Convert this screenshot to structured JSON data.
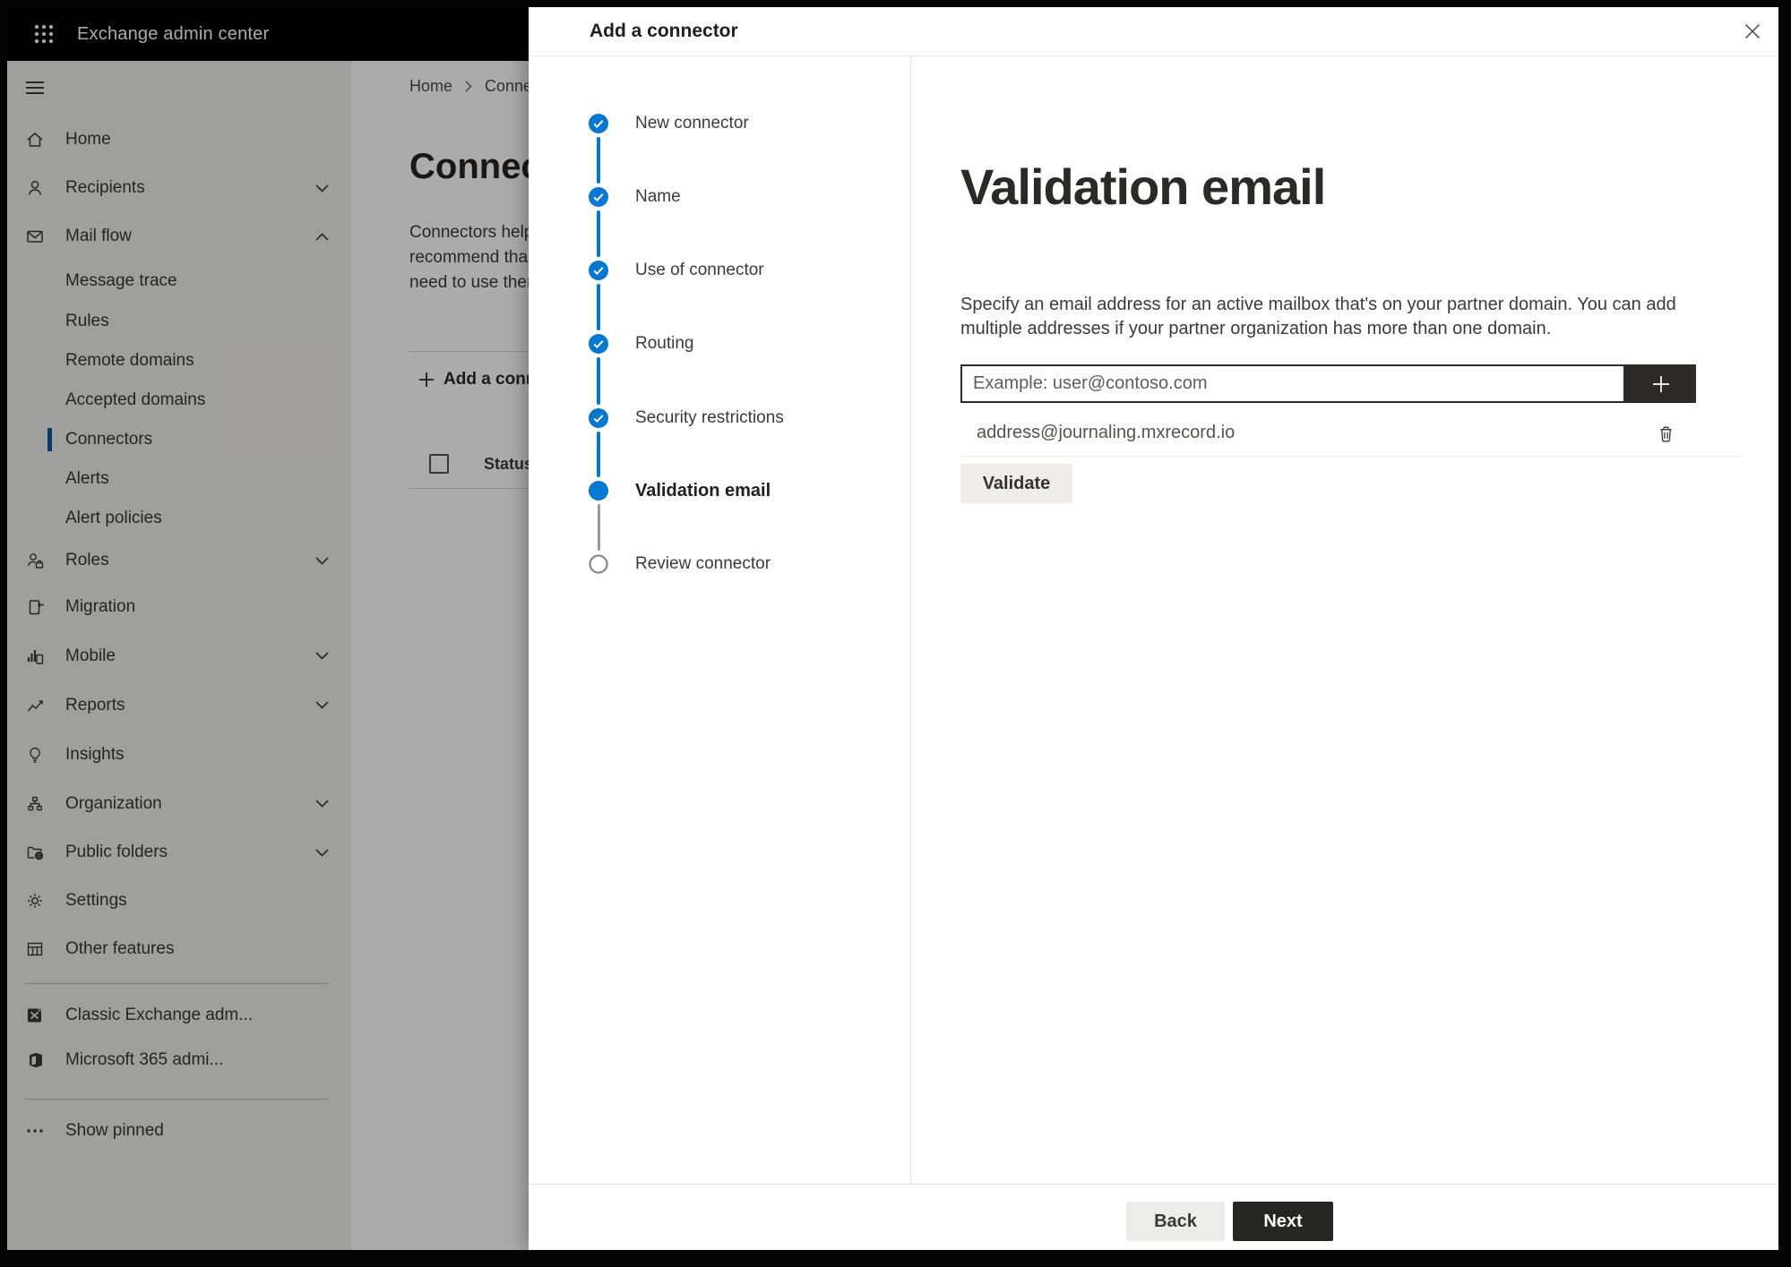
{
  "colors": {
    "accent": "#0078d4",
    "topbar": "#000000",
    "primary_button": "#262625",
    "panel": "#ffffff"
  },
  "topbar": {
    "title": "Exchange admin center"
  },
  "sidebar": {
    "items": [
      {
        "label": "Home",
        "icon": "home"
      },
      {
        "label": "Recipients",
        "icon": "person",
        "chevron": "down"
      },
      {
        "label": "Mail flow",
        "icon": "mail",
        "chevron": "up",
        "expanded": true
      },
      {
        "label": "Message trace",
        "child": true
      },
      {
        "label": "Rules",
        "child": true
      },
      {
        "label": "Remote domains",
        "child": true
      },
      {
        "label": "Accepted domains",
        "child": true
      },
      {
        "label": "Connectors",
        "child": true,
        "selected": true
      },
      {
        "label": "Alerts",
        "child": true
      },
      {
        "label": "Alert policies",
        "child": true
      },
      {
        "label": "Roles",
        "icon": "roles",
        "chevron": "down"
      },
      {
        "label": "Migration",
        "icon": "migration"
      },
      {
        "label": "Mobile",
        "icon": "mobile",
        "chevron": "down"
      },
      {
        "label": "Reports",
        "icon": "reports",
        "chevron": "down"
      },
      {
        "label": "Insights",
        "icon": "insights"
      },
      {
        "label": "Organization",
        "icon": "organization",
        "chevron": "down"
      },
      {
        "label": "Public folders",
        "icon": "public-folders",
        "chevron": "down"
      },
      {
        "label": "Settings",
        "icon": "settings"
      },
      {
        "label": "Other features",
        "icon": "other-features"
      },
      {
        "label": "Classic Exchange adm...",
        "icon": "exchange-logo"
      },
      {
        "label": "Microsoft 365 admi...",
        "icon": "m365-logo"
      },
      {
        "label": "Show pinned",
        "icon": "ellipsis"
      }
    ]
  },
  "page": {
    "breadcrumb_home": "Home",
    "breadcrumb_current": "Connectors",
    "title": "Connectors",
    "intro_line1": "Connectors help",
    "intro_line2": "recommend tha",
    "intro_line3": "need to use ther",
    "add_button": "Add a connector",
    "column_status": "Status"
  },
  "wizard": {
    "title": "Add a connector",
    "steps": [
      {
        "label": "New connector",
        "state": "done"
      },
      {
        "label": "Name",
        "state": "done"
      },
      {
        "label": "Use of connector",
        "state": "done"
      },
      {
        "label": "Routing",
        "state": "done"
      },
      {
        "label": "Security restrictions",
        "state": "done"
      },
      {
        "label": "Validation email",
        "state": "current"
      },
      {
        "label": "Review connector",
        "state": "todo"
      }
    ],
    "content": {
      "heading": "Validation email",
      "description_line1": "Specify an email address for an active mailbox that's on your partner domain. You can add",
      "description_line2": "multiple addresses if your partner organization has more than one domain.",
      "email_placeholder": "Example: user@contoso.com",
      "added_address": "address@journaling.mxrecord.io",
      "validate_label": "Validate"
    },
    "footer": {
      "back_label": "Back",
      "next_label": "Next"
    }
  }
}
